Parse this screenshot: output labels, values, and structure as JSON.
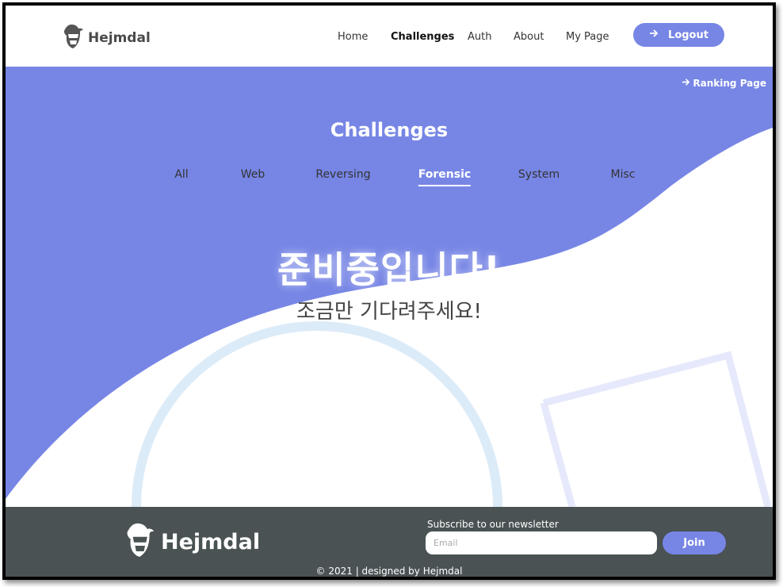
{
  "header": {
    "logo_text": "Hejmdal",
    "nav": [
      {
        "label": "Home",
        "active": false
      },
      {
        "label": "Challenges",
        "active": true
      },
      {
        "label": "Auth",
        "active": false
      },
      {
        "label": "About",
        "active": false
      },
      {
        "label": "My Page",
        "active": false
      }
    ],
    "logout_label": "Logout",
    "logout_icon": "arrow-right-icon"
  },
  "hero": {
    "ranking_label": "Ranking Page",
    "title": "Challenges",
    "tabs": [
      {
        "label": "All",
        "active": false
      },
      {
        "label": "Web",
        "active": false
      },
      {
        "label": "Reversing",
        "active": false
      },
      {
        "label": "Forensic",
        "active": true
      },
      {
        "label": "System",
        "active": false
      },
      {
        "label": "Misc",
        "active": false
      }
    ],
    "message_main": "준비중입니다!",
    "message_sub": "조금만 기다려주세요!"
  },
  "footer": {
    "logo_text": "Hejmdal",
    "newsletter_label": "Subscribe to our newsletter",
    "email_placeholder": "Email",
    "join_label": "Join",
    "copyright": "© 2021 | designed by Hejmdal"
  },
  "colors": {
    "accent": "#7786e5",
    "footer_bg": "#4a5254",
    "circle_decor": "#dcebf8",
    "square_decor": "#e6e9fb"
  }
}
